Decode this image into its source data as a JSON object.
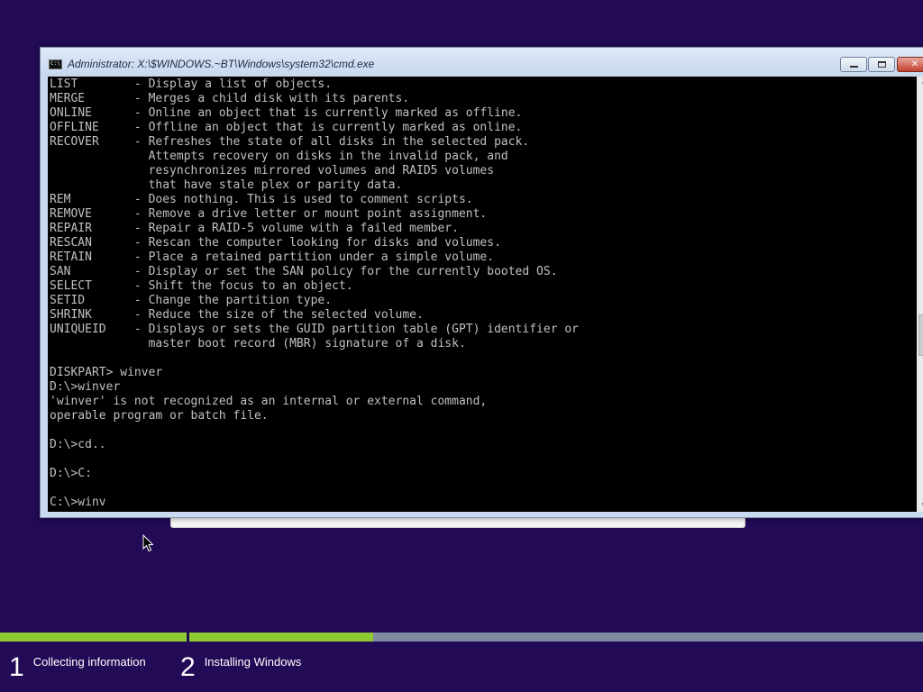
{
  "window": {
    "title": "Administrator: X:\\$WINDOWS.~BT\\Windows\\system32\\cmd.exe",
    "icon": "cmd-icon",
    "icon_text": "C:\\"
  },
  "console": {
    "lines": [
      "LIST        - Display a list of objects.",
      "MERGE       - Merges a child disk with its parents.",
      "ONLINE      - Online an object that is currently marked as offline.",
      "OFFLINE     - Offline an object that is currently marked as online.",
      "RECOVER     - Refreshes the state of all disks in the selected pack.",
      "              Attempts recovery on disks in the invalid pack, and",
      "              resynchronizes mirrored volumes and RAID5 volumes",
      "              that have stale plex or parity data.",
      "REM         - Does nothing. This is used to comment scripts.",
      "REMOVE      - Remove a drive letter or mount point assignment.",
      "REPAIR      - Repair a RAID-5 volume with a failed member.",
      "RESCAN      - Rescan the computer looking for disks and volumes.",
      "RETAIN      - Place a retained partition under a simple volume.",
      "SAN         - Display or set the SAN policy for the currently booted OS.",
      "SELECT      - Shift the focus to an object.",
      "SETID       - Change the partition type.",
      "SHRINK      - Reduce the size of the selected volume.",
      "UNIQUEID    - Displays or sets the GUID partition table (GPT) identifier or",
      "              master boot record (MBR) signature of a disk.",
      "",
      "DISKPART> winver",
      "D:\\>winver",
      "'winver' is not recognized as an internal or external command,",
      "operable program or batch file.",
      "",
      "D:\\>cd..",
      "",
      "D:\\>C:",
      "",
      "C:\\>winv"
    ],
    "text_color": "#c0c0c0",
    "background": "#000000"
  },
  "scrollbar": {
    "up_glyph": "^",
    "down_glyph": "v"
  },
  "setup": {
    "steps": [
      {
        "number": "1",
        "label": "Collecting information",
        "progress": 1.0
      },
      {
        "number": "2",
        "label": "Installing Windows",
        "progress": 0.25
      }
    ],
    "background": "#220a56",
    "progress_color": "#8ecb32",
    "track_color": "#7f8aa3"
  }
}
